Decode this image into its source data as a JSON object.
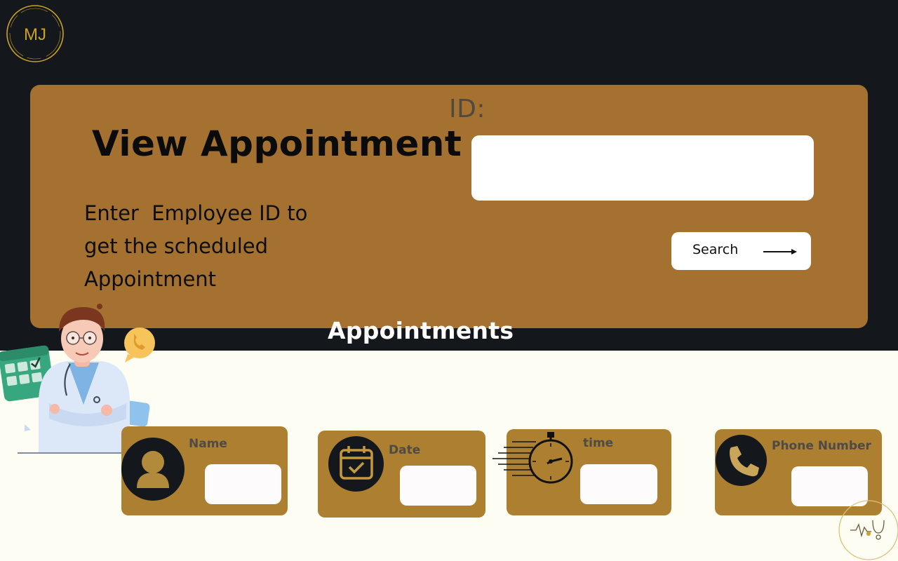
{
  "brand": {
    "logo_text": "MJ",
    "accent_color": "#c9a227"
  },
  "hero": {
    "title": "View Appointment",
    "description": "Enter  Employee ID to get the scheduled Appointment",
    "id_label": "ID:",
    "id_input_value": "",
    "search_label": "Search",
    "background_color": "#a47130"
  },
  "section": {
    "title": "Appointments"
  },
  "cards": {
    "name": {
      "label": "Name",
      "value": "",
      "icon": "user-icon"
    },
    "date": {
      "label": "Date",
      "value": "",
      "icon": "calendar-check-icon"
    },
    "time": {
      "label": "time",
      "value": "",
      "icon": "stopwatch-icon"
    },
    "phone": {
      "label": "Phone Number",
      "value": "",
      "icon": "phone-icon"
    }
  },
  "colors": {
    "dark_band": "#14171b",
    "page_background": "#fefdf3",
    "card_background": "#ad8031"
  }
}
